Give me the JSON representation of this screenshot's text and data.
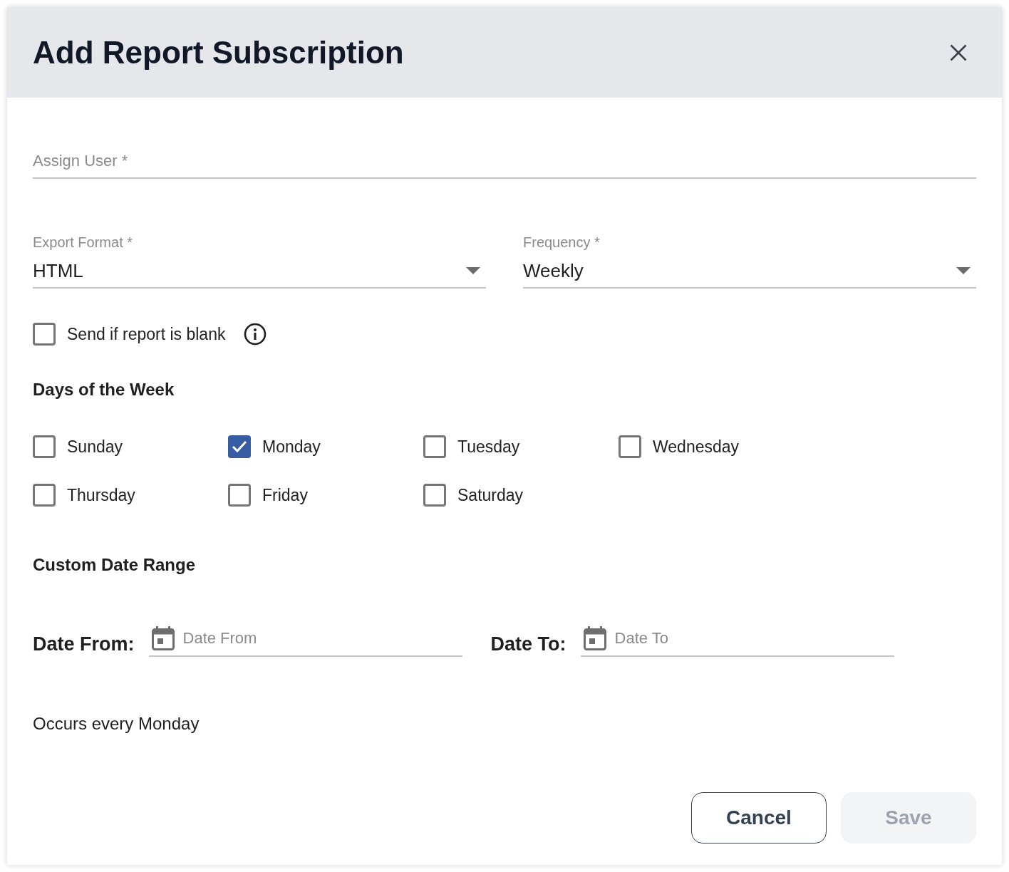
{
  "dialog": {
    "title": "Add Report Subscription"
  },
  "assign_user": {
    "placeholder": "Assign User *"
  },
  "selects": [
    {
      "label": "Export Format *",
      "value": "HTML"
    },
    {
      "label": "Frequency *",
      "value": "Weekly"
    }
  ],
  "send_if_blank": {
    "label": "Send if report is blank",
    "checked": false
  },
  "days": {
    "heading": "Days of the Week",
    "items": [
      {
        "label": "Sunday",
        "checked": false
      },
      {
        "label": "Monday",
        "checked": true
      },
      {
        "label": "Tuesday",
        "checked": false
      },
      {
        "label": "Wednesday",
        "checked": false
      },
      {
        "label": "Thursday",
        "checked": false
      },
      {
        "label": "Friday",
        "checked": false
      },
      {
        "label": "Saturday",
        "checked": false
      }
    ]
  },
  "date_range": {
    "heading": "Custom Date Range",
    "fields": [
      {
        "label": "Date From:",
        "placeholder": "Date From"
      },
      {
        "label": "Date To:",
        "placeholder": "Date To"
      }
    ]
  },
  "summary": "Occurs every Monday",
  "buttons": [
    {
      "label": "Cancel",
      "kind": "secondary",
      "disabled": false
    },
    {
      "label": "Save",
      "kind": "primary",
      "disabled": true
    }
  ]
}
